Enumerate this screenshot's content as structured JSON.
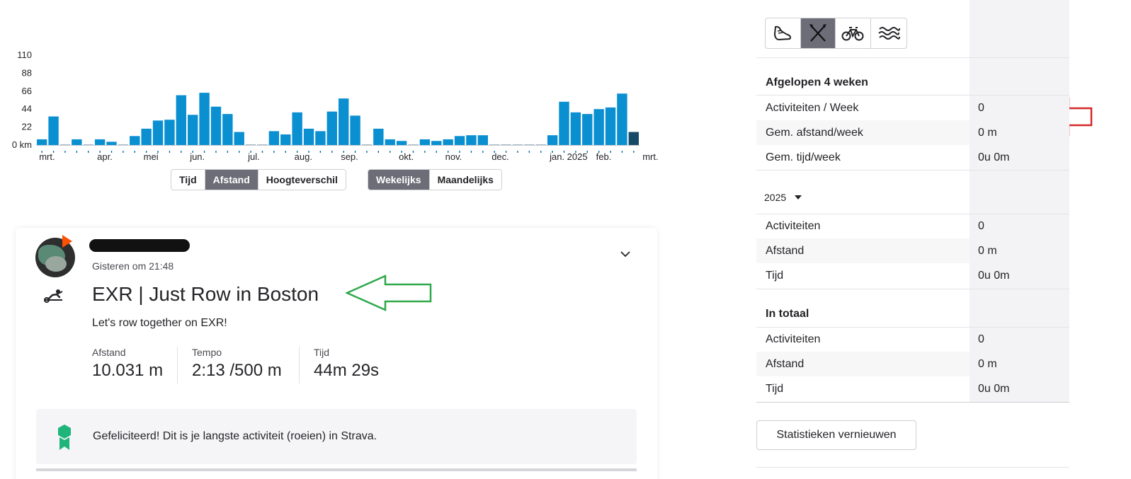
{
  "chart_data": {
    "type": "bar",
    "title": "",
    "xlabel": "",
    "ylabel": "",
    "yunit": "km",
    "ylim": [
      0,
      110
    ],
    "yticks": [
      "110",
      "88",
      "66",
      "44",
      "22",
      "0 km"
    ],
    "xticks": [
      {
        "label": "mrt.",
        "week": 0
      },
      {
        "label": "apr.",
        "week": 5
      },
      {
        "label": "mei",
        "week": 9
      },
      {
        "label": "jun.",
        "week": 13
      },
      {
        "label": "jul.",
        "week": 18
      },
      {
        "label": "aug.",
        "week": 22
      },
      {
        "label": "sep.",
        "week": 26
      },
      {
        "label": "okt.",
        "week": 31
      },
      {
        "label": "nov.",
        "week": 35
      },
      {
        "label": "dec.",
        "week": 39
      },
      {
        "label": "jan. 2025",
        "week": 44
      },
      {
        "label": "feb.",
        "week": 48
      },
      {
        "label": "mrt.",
        "week": 52
      }
    ],
    "series": [
      {
        "values": [
          7,
          35,
          0,
          7,
          0,
          7,
          4,
          0,
          11,
          20,
          30,
          31,
          61,
          37,
          64,
          47,
          38,
          16,
          0,
          0,
          17,
          13,
          40,
          20,
          17,
          41,
          57,
          36,
          0,
          20,
          7,
          5,
          0,
          7,
          5,
          7,
          11,
          12,
          12,
          0,
          0,
          0,
          0,
          0,
          12,
          53,
          40,
          38,
          44,
          46,
          63,
          16
        ]
      }
    ],
    "bar_color": "#0a8fd1",
    "current_bar_color": "#174a66",
    "grid": false
  },
  "toggles": {
    "metric": [
      "Tijd",
      "Afstand",
      "Hoogteverschil"
    ],
    "metric_active": "Afstand",
    "period": [
      "Wekelijks",
      "Maandelijks"
    ],
    "period_active": "Wekelijks"
  },
  "activity": {
    "time": "Gisteren om 21:48",
    "title": "EXR | Just Row in Boston",
    "description": "Let's row together on EXR!",
    "stats": [
      {
        "label": "Afstand",
        "value": "10.031 m"
      },
      {
        "label": "Tempo",
        "value": "2:13 /500 m"
      },
      {
        "label": "Tijd",
        "value": "44m 29s"
      }
    ],
    "achievement": "Gefeliciteerd! Dit is je langste activiteit (roeien) in Strava.",
    "sport_icon": "rowing-machine-icon",
    "accent_color": "#fc5200"
  },
  "sidebar": {
    "sport_tabs": [
      "running-shoe-icon",
      "rowing-oars-icon",
      "bike-icon",
      "swim-waves-icon"
    ],
    "sport_tab_active": 1,
    "recent": {
      "title": "Afgelopen 4 weken",
      "rows": [
        {
          "label": "Activiteiten / Week",
          "value": "0"
        },
        {
          "label": "Gem. afstand/week",
          "value": "0 m"
        },
        {
          "label": "Gem. tijd/week",
          "value": "0u 0m"
        }
      ]
    },
    "year": {
      "selected": "2025",
      "rows": [
        {
          "label": "Activiteiten",
          "value": "0"
        },
        {
          "label": "Afstand",
          "value": "0 m"
        },
        {
          "label": "Tijd",
          "value": "0u 0m"
        }
      ]
    },
    "total": {
      "title": "In totaal",
      "rows": [
        {
          "label": "Activiteiten",
          "value": "0"
        },
        {
          "label": "Afstand",
          "value": "0 m"
        },
        {
          "label": "Tijd",
          "value": "0u 0m"
        }
      ]
    },
    "refresh_label": "Statistieken vernieuwen"
  },
  "annotations": {
    "green_arrow_color": "#2ea84a",
    "red_arrow_color": "#d42a2a"
  }
}
